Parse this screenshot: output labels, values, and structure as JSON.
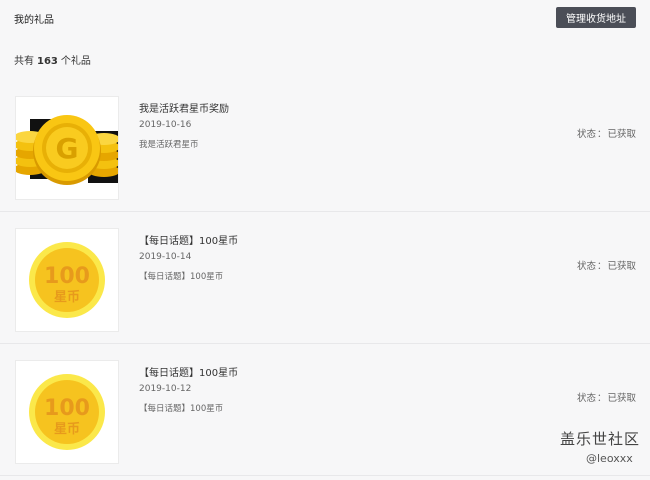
{
  "header": {
    "title": "我的礼品",
    "manage_button": "管理收货地址"
  },
  "summary": {
    "prefix": "共有",
    "count": "163",
    "suffix": "个礼品"
  },
  "gifts": [
    {
      "title": "我是活跃君星币奖励",
      "date": "2019-10-16",
      "desc": "我是活跃君星币",
      "status_label": "状态",
      "status_value": "已获取",
      "image": "gold-coin-stack-icon"
    },
    {
      "title": "【每日话题】100星币",
      "date": "2019-10-14",
      "desc": "【每日话题】100星币",
      "status_label": "状态",
      "status_value": "已获取",
      "image": "100-star-coin-icon",
      "coin_value": "100",
      "coin_unit": "星币"
    },
    {
      "title": "【每日话题】100星币",
      "date": "2019-10-12",
      "desc": "【每日话题】100星币",
      "status_label": "状态",
      "status_value": "已获取",
      "image": "100-star-coin-icon",
      "coin_value": "100",
      "coin_unit": "星币"
    }
  ],
  "watermark": {
    "line1": "盖乐世社区",
    "line2": "@leoxxx"
  },
  "colors": {
    "button_bg": "#4b4e57",
    "coin_gold": "#f5c518",
    "coin_text": "#e79a1c"
  }
}
